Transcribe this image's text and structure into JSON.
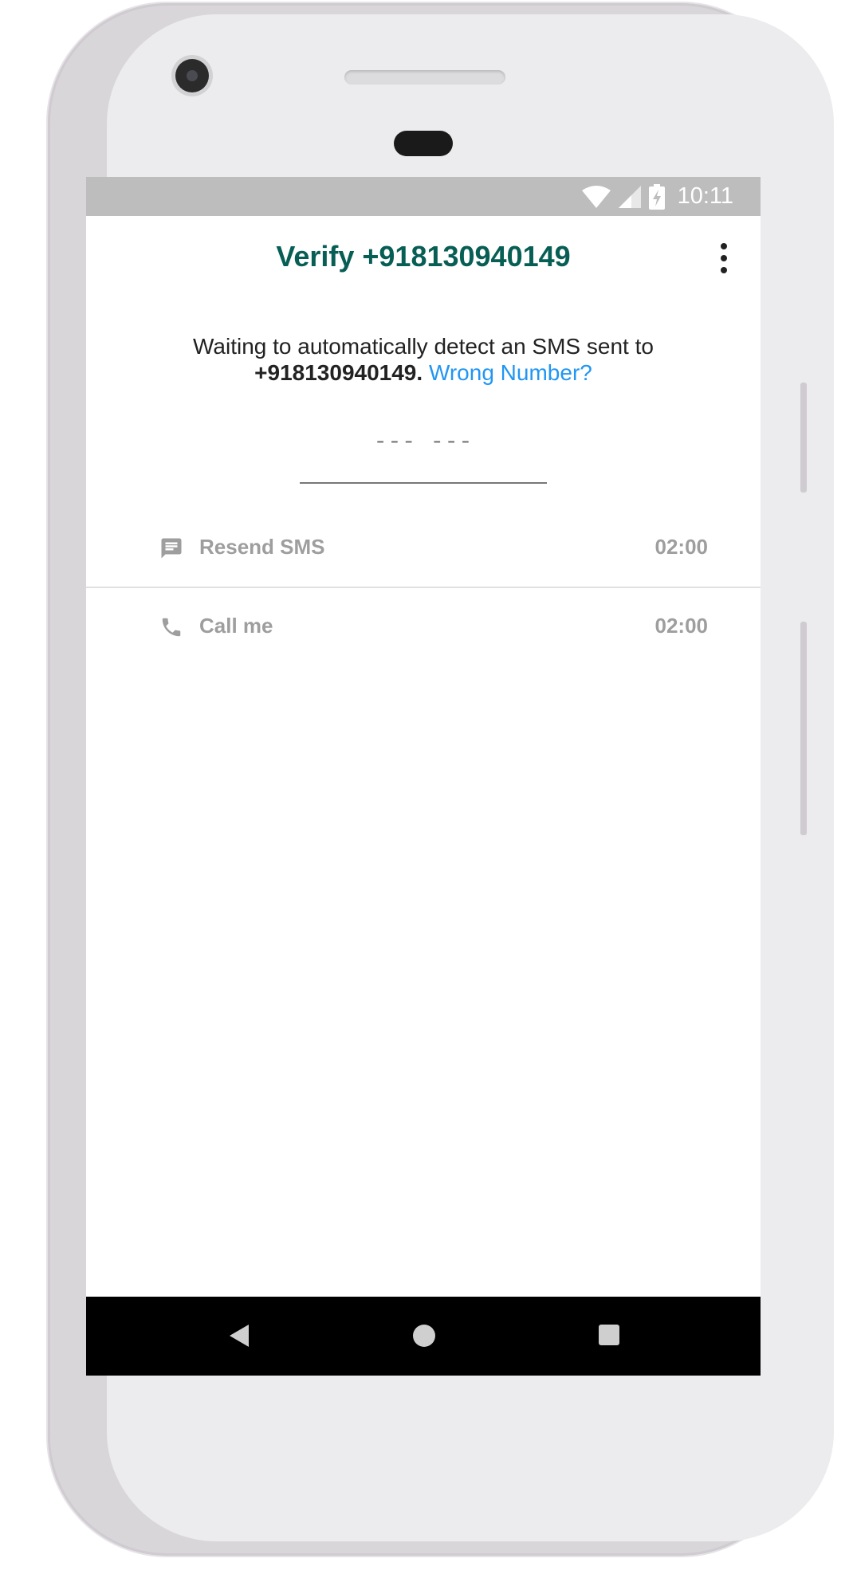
{
  "status_bar": {
    "time": "10:11",
    "icons": [
      "wifi-icon",
      "cell-signal-icon",
      "battery-charging-icon"
    ]
  },
  "app_bar": {
    "title": "Verify +918130940149",
    "menu_icon": "more-vert-icon"
  },
  "message": {
    "line1": "Waiting to automatically detect an SMS sent to",
    "phone": "+918130940149.",
    "link": "Wrong Number?"
  },
  "code_input": {
    "placeholder": "--- ---"
  },
  "actions": [
    {
      "icon": "message-icon",
      "label": "Resend SMS",
      "timer": "02:00"
    },
    {
      "icon": "phone-icon",
      "label": "Call me",
      "timer": "02:00"
    }
  ],
  "nav_bar": {
    "buttons": [
      "back-icon",
      "home-icon",
      "recents-icon"
    ]
  },
  "colors": {
    "title": "#075e54",
    "link": "#2196f3",
    "status_bar": "#bdbdbd",
    "muted": "#9e9e9e"
  }
}
